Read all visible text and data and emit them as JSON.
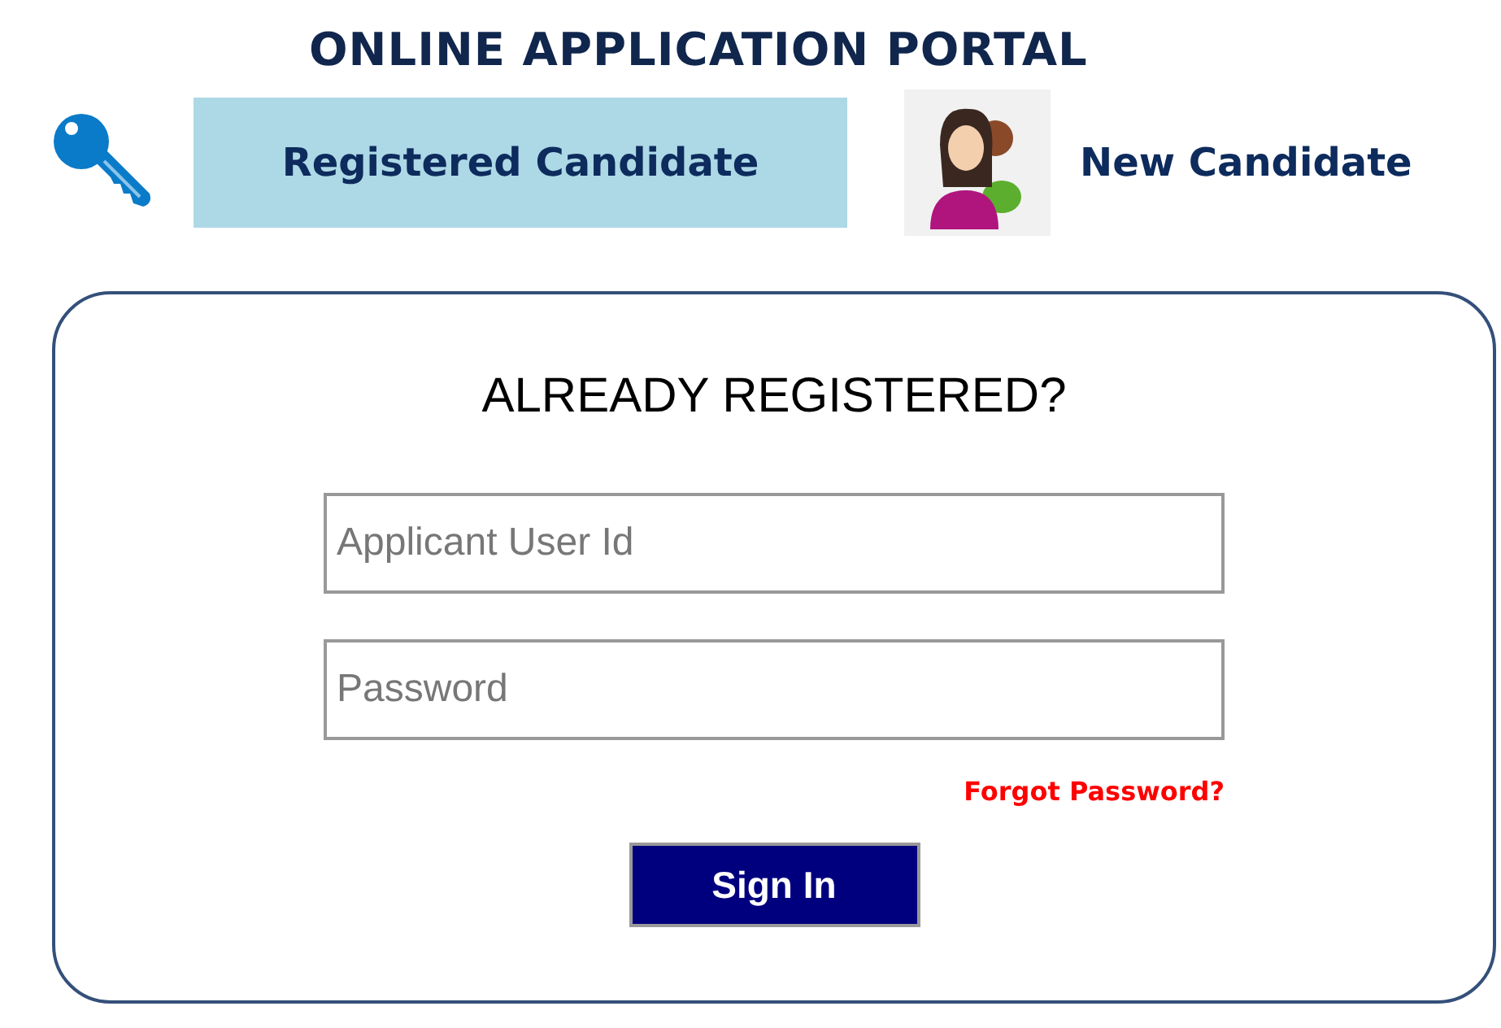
{
  "title": "ONLINE APPLICATION PORTAL",
  "tabs": [
    {
      "label": "Registered Candidate",
      "kind": "key",
      "selected": true
    },
    {
      "label": "New Candidate",
      "kind": "people",
      "selected": false
    }
  ],
  "login": {
    "heading": "ALREADY REGISTERED?",
    "fields": [
      {
        "placeholder": "Applicant User Id"
      },
      {
        "placeholder": "Password"
      }
    ],
    "forgot_link": "Forgot Password?",
    "button": "Sign In"
  }
}
